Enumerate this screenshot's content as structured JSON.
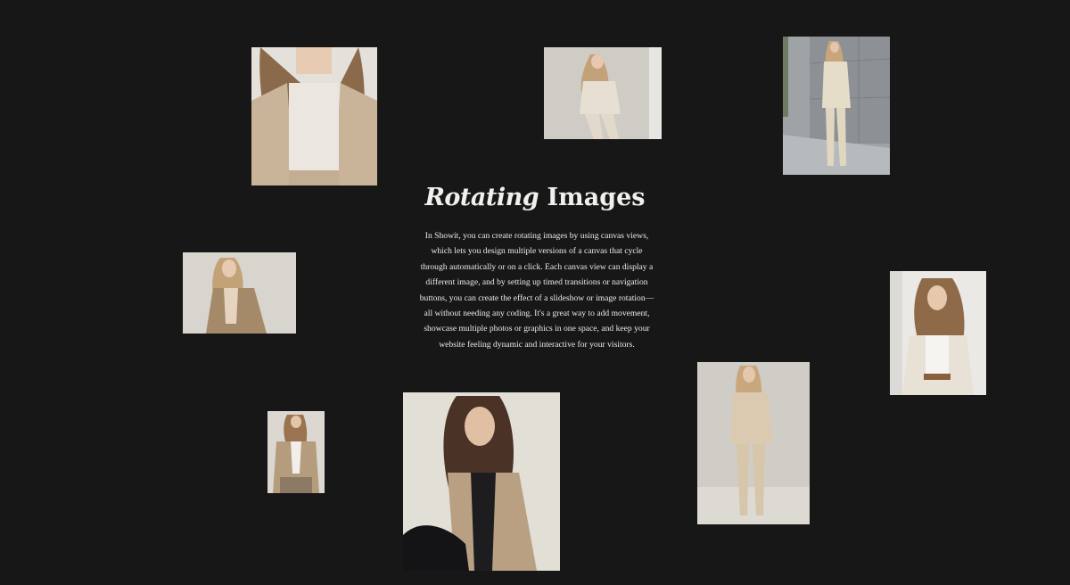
{
  "section": {
    "heading_italic": "Rotating",
    "heading_regular": "Images",
    "body": "In Showit, you can create rotating images by using canvas views, which lets you design multiple versions of a canvas that cycle through automatically or on a click. Each canvas view can display a different image, and by setting up timed transitions or navigation buttons, you can create the effect of a slideshow or image rotation—all without needing any coding. It's a great way to add movement, showcase multiple photos or graphics in one space, and keep your website feeling dynamic and interactive for your visitors."
  },
  "colors": {
    "background": "#171717",
    "text": "#f2f0ec"
  }
}
